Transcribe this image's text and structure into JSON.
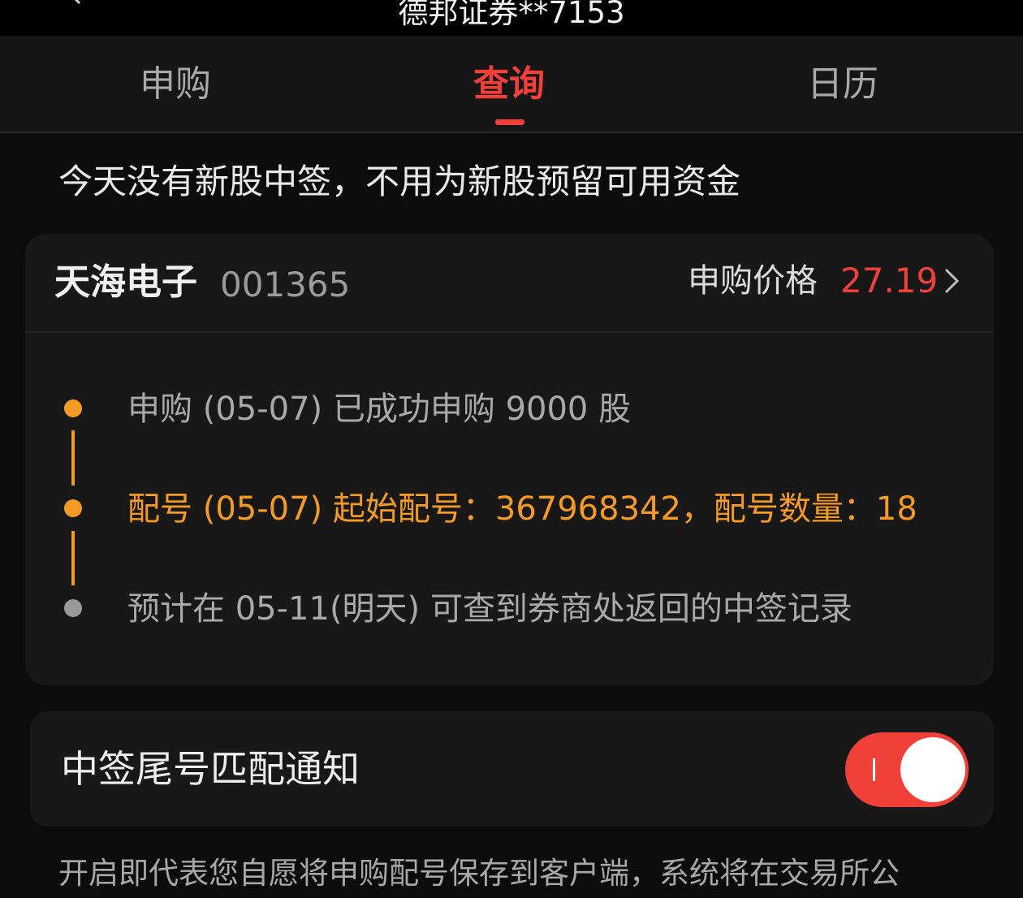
{
  "header": {
    "title": "德邦证券**7153"
  },
  "tabs": [
    {
      "label": "申购",
      "active": false
    },
    {
      "label": "查询",
      "active": true
    },
    {
      "label": "日历",
      "active": false
    }
  ],
  "notice": "今天没有新股中签，不用为新股预留可用资金",
  "stock_card": {
    "name": "天海电子",
    "code": "001365",
    "price_label": "申购价格",
    "price": "27.19",
    "steps": [
      {
        "text": "申购 (05-07) 已成功申购 9000 股",
        "status": "done"
      },
      {
        "text": "配号 (05-07) 起始配号：367968342，配号数量：18",
        "status": "current"
      },
      {
        "text": "预计在 05-11(明天) 可查到券商处返回的中签记录",
        "status": "pending"
      }
    ]
  },
  "notification": {
    "label": "中签尾号匹配通知",
    "enabled": true
  },
  "footer_text": "开启即代表您自愿将申购配号保存到客户端，系统将在交易所公",
  "colors": {
    "accent": "#f1403a",
    "step_active": "#f59a23",
    "step_pending": "#9a9a9a",
    "background": "#0c0c0c",
    "card": "#181818"
  }
}
